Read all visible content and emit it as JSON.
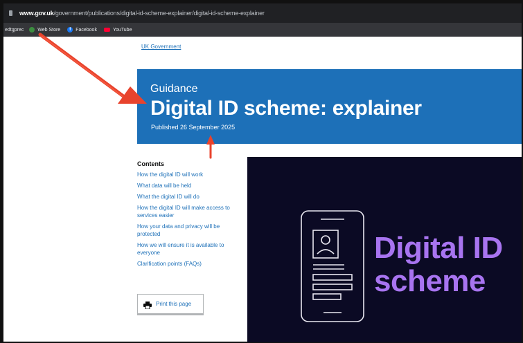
{
  "browser": {
    "url_host": "www.gov.uk",
    "url_path": "/government/publications/digital-id-scheme-explainer/digital-id-scheme-explainer",
    "bookmarks": [
      {
        "label": "edtgprec",
        "icon": "none"
      },
      {
        "label": "Web Store",
        "icon": "chrome-web-store-icon"
      },
      {
        "label": "Facebook",
        "icon": "facebook-icon"
      },
      {
        "label": "YouTube",
        "icon": "youtube-icon"
      }
    ]
  },
  "page": {
    "breadcrumb": "UK Government",
    "hero": {
      "caption": "Guidance",
      "title": "Digital ID scheme: explainer",
      "published": "Published 26 September 2025"
    },
    "contents": {
      "heading": "Contents",
      "links": [
        "How the digital ID will work",
        "What data will be held",
        "What the digital ID will do",
        "How the digital ID will make access to services easier",
        "How your data and privacy will be protected",
        "How we will ensure it is available to everyone",
        "Clarification points (FAQs)"
      ]
    },
    "print_label": "Print this page",
    "image_text_line1": "Digital ID",
    "image_text_line2": "scheme"
  },
  "colors": {
    "gov_blue": "#1d70b8",
    "hero_text": "#ffffff",
    "image_bg": "#0b0a24",
    "image_accent": "#a874f0",
    "annotation_arrow": "#e8432d"
  }
}
